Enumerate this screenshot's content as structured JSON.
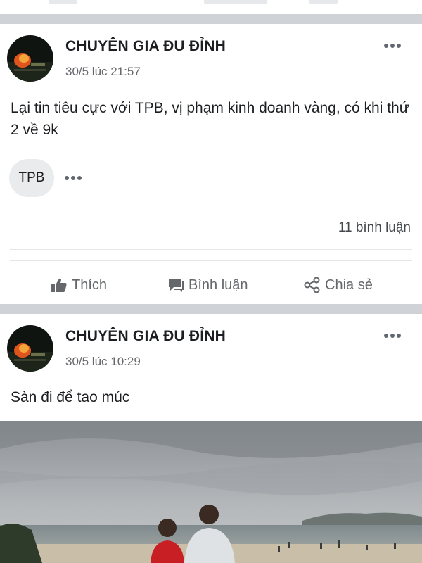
{
  "posts": [
    {
      "author": "CHUYÊN GIA ĐU ĐỈNH",
      "timestamp": "30/5 lúc 21:57",
      "text": "Lại tin tiêu cực với TPB, vị phạm kinh doanh vàng, có khi thứ 2 về 9k",
      "tag": "TPB",
      "comment_count": "11 bình luận",
      "actions": {
        "like": "Thích",
        "comment": "Bình luận",
        "share": "Chia sẻ"
      }
    },
    {
      "author": "CHUYÊN GIA ĐU ĐỈNH",
      "timestamp": "30/5 lúc 10:29",
      "text": "Sàn đi để tao múc"
    }
  ],
  "icons": [
    "more-icon",
    "like-icon",
    "comment-icon",
    "share-icon"
  ],
  "colors": {
    "secondary_text": "#65676b",
    "separator": "#cfd2d7"
  }
}
